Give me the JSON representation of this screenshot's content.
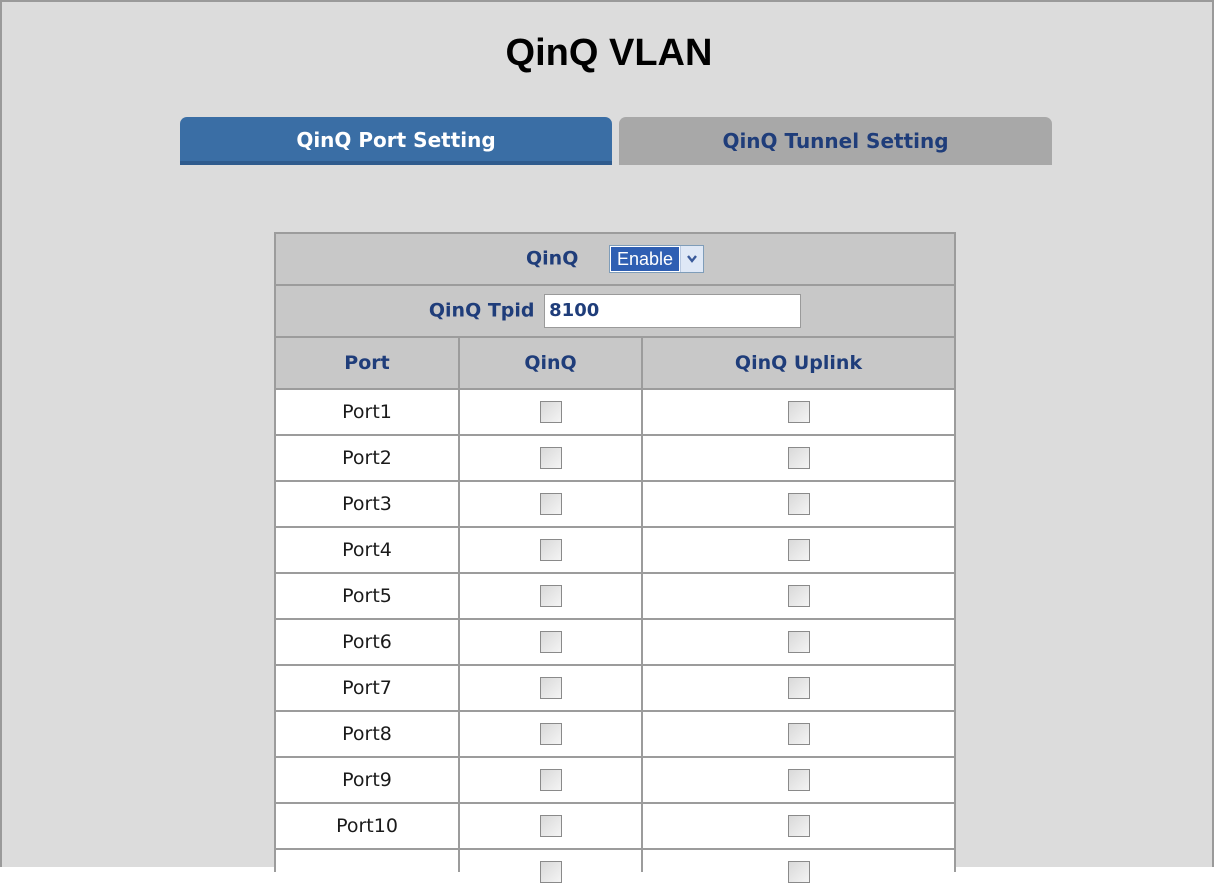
{
  "page": {
    "title": "QinQ VLAN"
  },
  "tabs": [
    {
      "label": "QinQ Port Setting",
      "active": true
    },
    {
      "label": "QinQ Tunnel Setting",
      "active": false
    }
  ],
  "qinq": {
    "label": "QinQ",
    "selected": "Enable"
  },
  "tpid": {
    "label": "QinQ Tpid",
    "value": "8100"
  },
  "columns": {
    "port": "Port",
    "qinq": "QinQ",
    "uplink": "QinQ Uplink"
  },
  "rows": [
    {
      "port": "Port1",
      "qinq": false,
      "uplink": false
    },
    {
      "port": "Port2",
      "qinq": false,
      "uplink": false
    },
    {
      "port": "Port3",
      "qinq": false,
      "uplink": false
    },
    {
      "port": "Port4",
      "qinq": false,
      "uplink": false
    },
    {
      "port": "Port5",
      "qinq": false,
      "uplink": false
    },
    {
      "port": "Port6",
      "qinq": false,
      "uplink": false
    },
    {
      "port": "Port7",
      "qinq": false,
      "uplink": false
    },
    {
      "port": "Port8",
      "qinq": false,
      "uplink": false
    },
    {
      "port": "Port9",
      "qinq": false,
      "uplink": false
    },
    {
      "port": "Port10",
      "qinq": false,
      "uplink": false
    },
    {
      "port": "",
      "qinq": false,
      "uplink": false
    }
  ],
  "colors": {
    "active_tab": "#3a6ea5",
    "inactive_tab": "#a8a8a8",
    "label_blue": "#1f3d7a",
    "header_gray": "#c8c8c8"
  }
}
